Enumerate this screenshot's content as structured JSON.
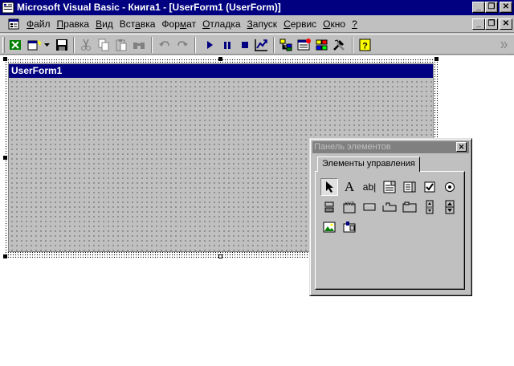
{
  "window": {
    "title": "Microsoft Visual Basic - Книга1 - [UserForm1 (UserForm)]",
    "controls": {
      "minimize": "_",
      "restore": "❐",
      "close": "✕"
    }
  },
  "menu": {
    "items": [
      {
        "pre": "",
        "key": "Ф",
        "post": "айл"
      },
      {
        "pre": "",
        "key": "П",
        "post": "равка"
      },
      {
        "pre": "",
        "key": "В",
        "post": "ид"
      },
      {
        "pre": "Вст",
        "key": "а",
        "post": "вка"
      },
      {
        "pre": "Фор",
        "key": "м",
        "post": "ат"
      },
      {
        "pre": "",
        "key": "О",
        "post": "тладка"
      },
      {
        "pre": "",
        "key": "З",
        "post": "апуск"
      },
      {
        "pre": "",
        "key": "С",
        "post": "ервис"
      },
      {
        "pre": "",
        "key": "О",
        "post": "кно"
      },
      {
        "pre": "",
        "key": "?",
        "post": ""
      }
    ]
  },
  "toolbar": {
    "icons": [
      "excel-view-icon",
      "insert-userform-icon",
      "save-icon",
      "cut-icon",
      "copy-icon",
      "paste-icon",
      "find-icon",
      "undo-icon",
      "redo-icon",
      "run-icon",
      "break-icon",
      "reset-icon",
      "design-mode-icon",
      "project-explorer-icon",
      "properties-icon",
      "object-browser-icon",
      "toolbox-icon",
      "help-icon"
    ]
  },
  "userform": {
    "caption": "UserForm1"
  },
  "toolbox": {
    "title": "Панель элементов",
    "close": "✕",
    "tab_label": "Элементы управления",
    "label_glyph": "A",
    "textbox_glyph": "ab|"
  },
  "colors": {
    "title_active": "#000080",
    "title_inactive": "#808080",
    "face": "#c0c0c0"
  }
}
